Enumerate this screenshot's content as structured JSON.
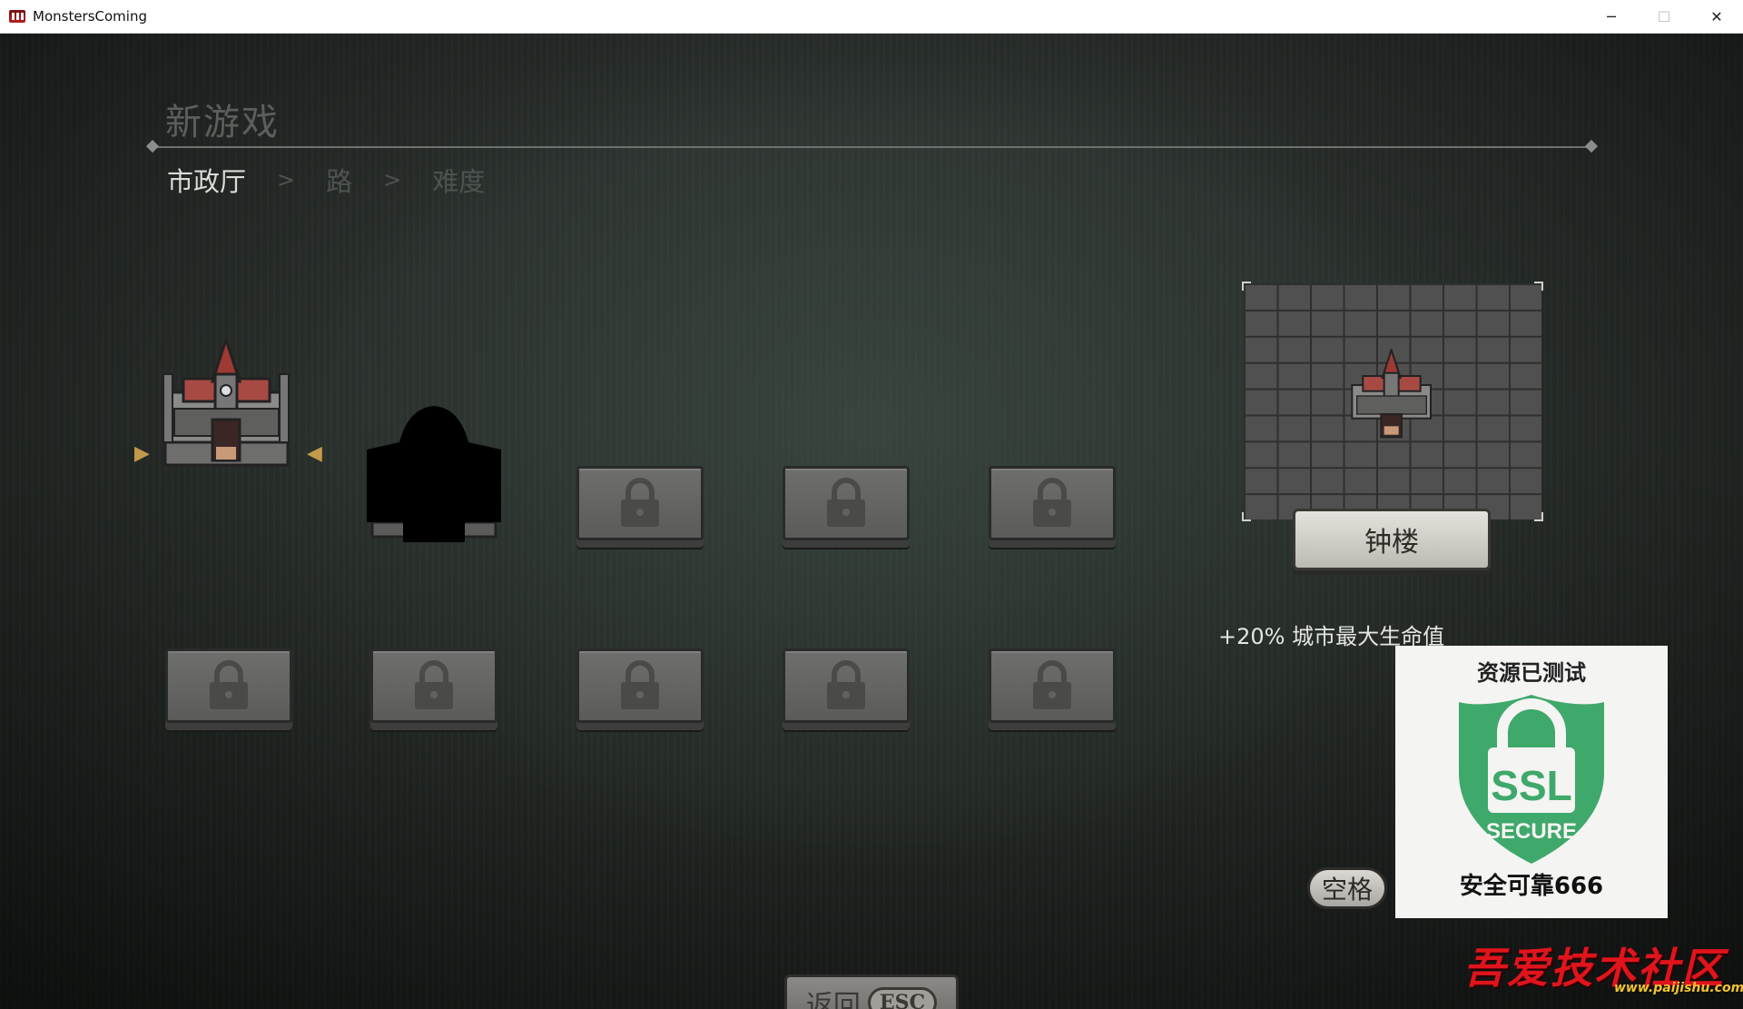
{
  "window": {
    "title": "MonstersComing",
    "controls": [
      "─",
      "☐",
      "✕"
    ]
  },
  "header": {
    "title": "新游戏",
    "steps": [
      {
        "label": "市政厅",
        "active": true
      },
      {
        "label": "路",
        "active": false
      },
      {
        "label": "难度",
        "active": false
      }
    ],
    "step_separator": ">"
  },
  "buildings": {
    "rows": [
      [
        {
          "state": "selected",
          "icon": "town-hall-icon"
        },
        {
          "state": "silhouette",
          "icon": "unknown-building-icon"
        },
        {
          "state": "locked",
          "icon": "lock-icon"
        },
        {
          "state": "locked",
          "icon": "lock-icon"
        },
        {
          "state": "locked",
          "icon": "lock-icon"
        }
      ],
      [
        {
          "state": "locked",
          "icon": "lock-icon"
        },
        {
          "state": "locked",
          "icon": "lock-icon"
        },
        {
          "state": "locked",
          "icon": "lock-icon"
        },
        {
          "state": "locked",
          "icon": "lock-icon"
        },
        {
          "state": "locked",
          "icon": "lock-icon"
        }
      ]
    ]
  },
  "preview": {
    "building_name": "钟楼",
    "bonus": "+20% 城市最大生命值"
  },
  "buttons": {
    "space_label": "空格",
    "back_label": "返回",
    "back_key": "ESC"
  },
  "ssl_badge": {
    "top_text": "资源已测试",
    "shield_line1": "SSL",
    "shield_line2": "SECURE",
    "bottom_text": "安全可靠666"
  },
  "watermark": {
    "text": "吾爱技术社区",
    "url": "www.paijishu.com"
  },
  "colors": {
    "accent_gold": "#c39a4b",
    "ssl_green": "#3fa86b",
    "watermark_red": "#e0141c"
  }
}
